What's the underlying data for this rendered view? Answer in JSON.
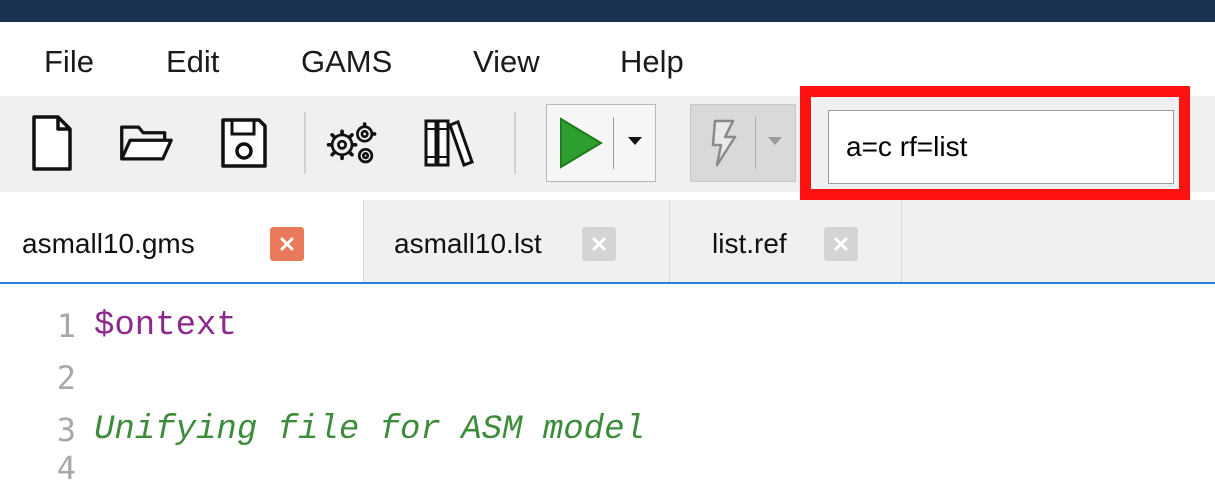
{
  "menu": {
    "items": [
      {
        "label": "File"
      },
      {
        "label": "Edit"
      },
      {
        "label": "GAMS"
      },
      {
        "label": "View"
      },
      {
        "label": "Help"
      }
    ]
  },
  "toolbar": {
    "icons": [
      "new-file-icon",
      "open-folder-icon",
      "save-icon",
      "settings-gears-icon",
      "model-library-icon",
      "run-icon",
      "dropdown-arrow-icon",
      "interrupt-icon"
    ],
    "params_value": "a=c rf=list",
    "highlight_color": "#ff1212",
    "run_color": "#2e9e2e"
  },
  "tabs": [
    {
      "label": "asmall10.gms",
      "active": true
    },
    {
      "label": "asmall10.lst",
      "active": false
    },
    {
      "label": "list.ref",
      "active": false
    }
  ],
  "editor": {
    "lines": [
      {
        "num": "1",
        "text": "$ontext"
      },
      {
        "num": "2",
        "text": ""
      },
      {
        "num": "3",
        "text": "Unifying file for ASM model"
      },
      {
        "num": "4",
        "text": ""
      }
    ]
  }
}
